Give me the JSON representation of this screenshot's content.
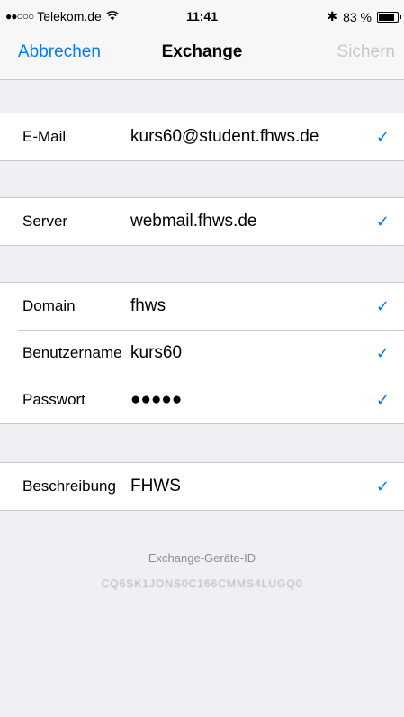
{
  "status_bar": {
    "signal": "●●○○○",
    "carrier": "Telekom.de",
    "wifi_icon": "wifi-icon",
    "time": "11:41",
    "bluetooth": "✱",
    "battery_text": "83 %",
    "battery_level": 0.83
  },
  "nav": {
    "cancel": "Abbrechen",
    "title": "Exchange",
    "save": "Sichern"
  },
  "fields": {
    "email": {
      "label": "E-Mail",
      "value": "kurs60@student.fhws.de"
    },
    "server": {
      "label": "Server",
      "value": "webmail.fhws.de"
    },
    "domain": {
      "label": "Domain",
      "value": "fhws"
    },
    "username": {
      "label": "Benutzername",
      "value": "kurs60"
    },
    "password": {
      "label": "Passwort",
      "value": "●●●●●"
    },
    "description": {
      "label": "Beschreibung",
      "value": "FHWS"
    }
  },
  "check_glyph": "✓",
  "footer": {
    "device_id_label": "Exchange-Geräte-ID",
    "device_id": "CQ6SK1JONS0C166CMMS4LUGQ0"
  },
  "colors": {
    "accent": "#007aff",
    "disabled": "#c7c7cc",
    "background": "#efeff4"
  }
}
